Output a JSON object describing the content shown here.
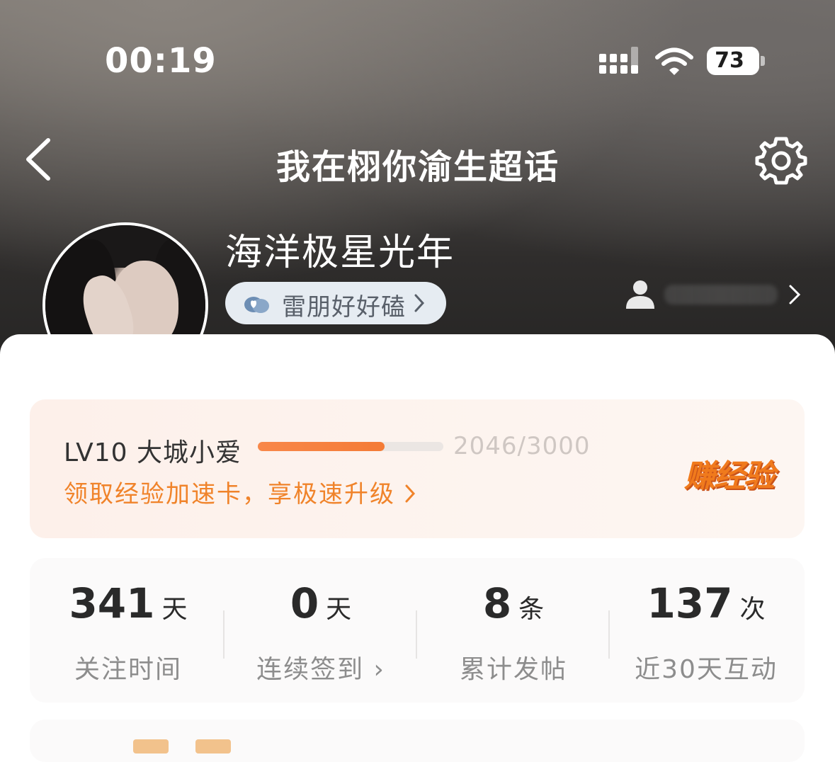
{
  "status_bar": {
    "time": "00:19",
    "battery": "73"
  },
  "nav": {
    "title": "我在栩你渝生超话"
  },
  "profile": {
    "name": "海洋极星光年",
    "group_chip": "雷朋好好磕 "
  },
  "level": {
    "name": "LV10 大城小爱",
    "progress_text": "2046/3000",
    "progress_fraction": 0.682,
    "promo": "领取经验加速卡，享极速升级",
    "earn_button": "赚经验"
  },
  "stats": [
    {
      "number": "341",
      "unit": "天",
      "label": "关注时间"
    },
    {
      "number": "0",
      "unit": "天",
      "label": "连续签到 ›"
    },
    {
      "number": "8",
      "unit": "条",
      "label": "累计发帖"
    },
    {
      "number": "137",
      "unit": "次",
      "label": "近30天互动"
    }
  ],
  "colors": {
    "accent": "#f0832a",
    "progress": "#f47b36"
  }
}
